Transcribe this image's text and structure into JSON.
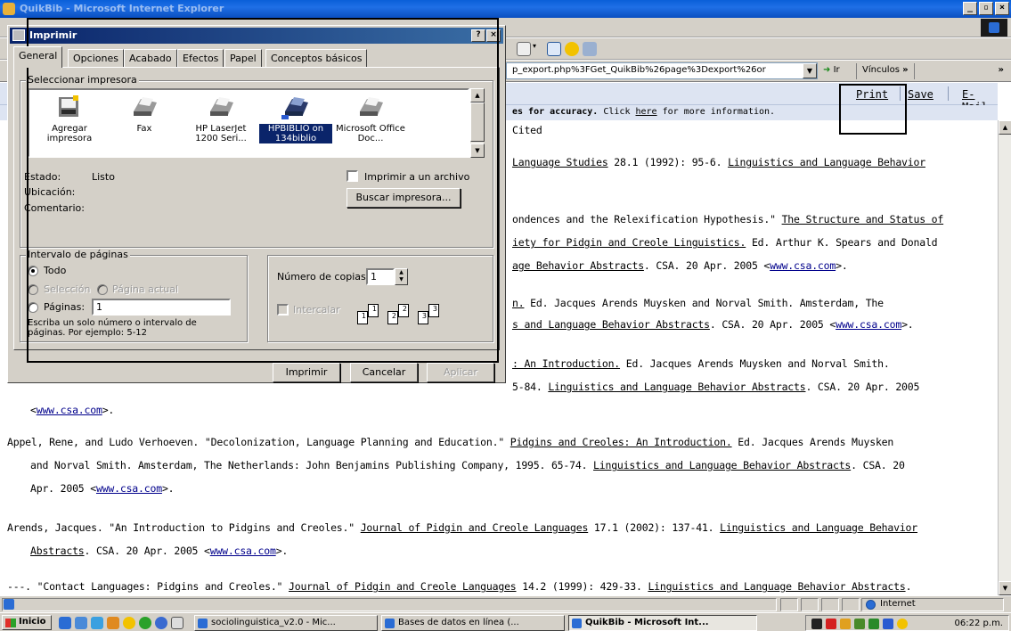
{
  "browser": {
    "title": "QuikBib - Microsoft Internet Explorer",
    "address_value": "p_export.php%3FGet_QuikBib%26page%3Dexport%26or",
    "go_label": "Ir",
    "links_label": "Vínculos",
    "links_chevron": "»",
    "toolbar_overflow": "»"
  },
  "page_toolbar": {
    "print_label": "Print",
    "save_label": "Save",
    "email_label": "E-Mail"
  },
  "notice": {
    "bold_text": "es for accuracy.",
    "prefix": "Click",
    "link_text": "here",
    "suffix": "for more information."
  },
  "content_lines": [
    {
      "parts": [
        {
          "t": "Cited"
        }
      ]
    },
    {
      "parts": [
        {
          "t": "Language Studies",
          "u": true
        },
        {
          "t": " 28.1 (1992): 95-6. "
        },
        {
          "t": "Linguistics and Language Behavior",
          "u": true
        }
      ]
    },
    {
      "parts": [
        {
          "t": "ondences and the Relexification Hypothesis.\" "
        },
        {
          "t": "The Structure and Status of",
          "u": true
        }
      ]
    },
    {
      "parts": [
        {
          "t": "iety for Pidgin and Creole Linguistics.",
          "u": true
        },
        {
          "t": " Ed. Arthur K. Spears and Donald"
        }
      ]
    },
    {
      "parts": [
        {
          "t": "age Behavior Abstracts",
          "u": true
        },
        {
          "t": ". CSA. 20 Apr. 2005 <"
        },
        {
          "t": "www.csa.com",
          "a": true
        },
        {
          "t": ">."
        }
      ]
    },
    {
      "parts": [
        {
          "t": "n.",
          "u": true
        },
        {
          "t": " Ed. Jacques Arends Muysken and Norval Smith. Amsterdam, The"
        }
      ]
    },
    {
      "parts": [
        {
          "t": "s and Language Behavior Abstracts",
          "u": true
        },
        {
          "t": ". CSA. 20 Apr. 2005 <"
        },
        {
          "t": "www.csa.com",
          "a": true
        },
        {
          "t": ">."
        }
      ]
    },
    {
      "parts": [
        {
          "t": ": An Introduction.",
          "u": true
        },
        {
          "t": " Ed. Jacques Arends Muysken and Norval Smith."
        }
      ]
    },
    {
      "parts": [
        {
          "t": "5-84. "
        },
        {
          "t": "Linguistics and Language Behavior Abstracts",
          "u": true
        },
        {
          "t": ". CSA. 20 Apr. 2005"
        }
      ]
    },
    {
      "parts": [
        {
          "t": "<"
        },
        {
          "t": "www.csa.com",
          "a": true
        },
        {
          "t": ">."
        }
      ]
    },
    {
      "parts": [
        {
          "t": "Appel, Rene, and Ludo Verhoeven. \"Decolonization, Language Planning and Education.\" "
        },
        {
          "t": "Pidgins and Creoles: An Introduction.",
          "u": true
        },
        {
          "t": " Ed. Jacques Arends Muysken"
        }
      ]
    },
    {
      "parts": [
        {
          "t": "and Norval Smith. Amsterdam, The Netherlands: John Benjamins Publishing Company, 1995. 65-74. "
        },
        {
          "t": "Linguistics and Language Behavior Abstracts",
          "u": true
        },
        {
          "t": ". CSA. 20"
        }
      ]
    },
    {
      "parts": [
        {
          "t": "Apr. 2005 <"
        },
        {
          "t": "www.csa.com",
          "a": true
        },
        {
          "t": ">."
        }
      ]
    },
    {
      "parts": [
        {
          "t": "Arends, Jacques. \"An Introduction to Pidgins and Creoles.\" "
        },
        {
          "t": "Journal of Pidgin and Creole Languages",
          "u": true
        },
        {
          "t": " 17.1 (2002): 137-41. "
        },
        {
          "t": "Linguistics and Language Behavior",
          "u": true
        }
      ]
    },
    {
      "parts": [
        {
          "t": "Abstracts",
          "u": true
        },
        {
          "t": ". CSA. 20 Apr. 2005 <"
        },
        {
          "t": "www.csa.com",
          "a": true
        },
        {
          "t": ">."
        }
      ]
    },
    {
      "parts": [
        {
          "t": "---. \"Contact Languages: Pidgins and Creoles.\" "
        },
        {
          "t": "Journal of Pidgin and Creole Languages",
          "u": true
        },
        {
          "t": " 14.2 (1999): 429-33. "
        },
        {
          "t": "Linguistics and Language Behavior Abstracts",
          "u": true
        },
        {
          "t": "."
        }
      ]
    }
  ],
  "dialog": {
    "title": "Imprimir",
    "help_btn": "?",
    "close_btn": "×",
    "tabs": [
      "General",
      "Opciones",
      "Acabado",
      "Efectos",
      "Papel",
      "Conceptos básicos"
    ],
    "select_printer_label": "Seleccionar impresora",
    "printers": [
      {
        "name": "Agregar impresora",
        "selected": false
      },
      {
        "name": "Fax",
        "selected": false
      },
      {
        "name": "HP LaserJet 1200 Seri...",
        "selected": false
      },
      {
        "name": "HPBIBLIO on 134biblio",
        "selected": true
      },
      {
        "name": "Microsoft Office Doc...",
        "selected": false
      }
    ],
    "status_label": "Estado:",
    "status_value": "Listo",
    "location_label": "Ubicación:",
    "comment_label": "Comentario:",
    "print_to_file_label": "Imprimir a un archivo",
    "find_printer_button": "Buscar impresora...",
    "page_range_label": "Intervalo de páginas",
    "range_all": "Todo",
    "range_selection": "Selección",
    "range_current": "Página actual",
    "range_pages": "Páginas:",
    "pages_value": "1",
    "pages_hint": "Escriba un solo número o intervalo de páginas. Por ejemplo: 5-12",
    "copies_label": "Número de copias:",
    "copies_value": "1",
    "collate_label": "Intercalar",
    "print_button": "Imprimir",
    "cancel_button": "Cancelar",
    "apply_button": "Aplicar"
  },
  "statusbar": {
    "zone": "Internet"
  },
  "taskbar": {
    "start": "Inicio",
    "tasks": [
      {
        "label": "sociolinguistica_v2.0 - Mic...",
        "active": false
      },
      {
        "label": "Bases de datos en línea (...",
        "active": false
      },
      {
        "label": "QuikBib - Microsoft Int...",
        "active": true
      }
    ],
    "clock": "06:22 p.m."
  }
}
